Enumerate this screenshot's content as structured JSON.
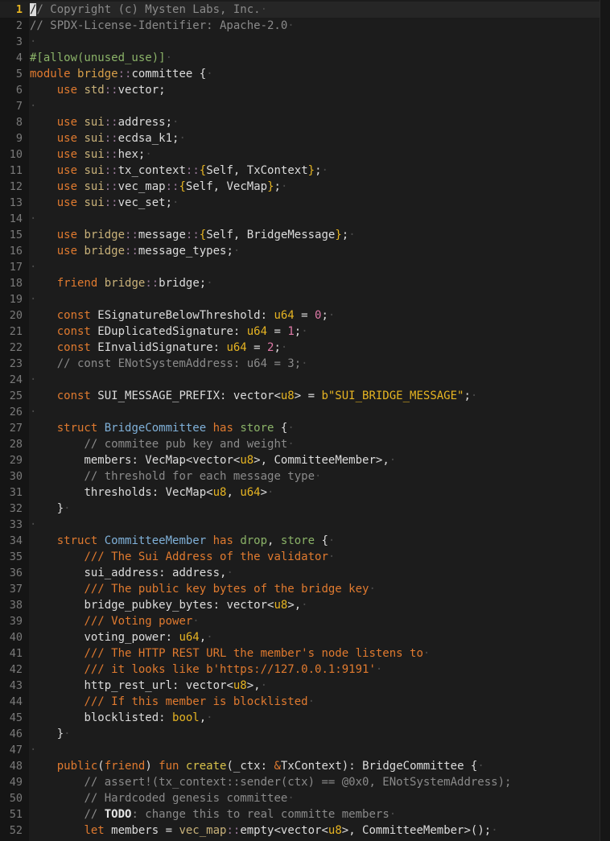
{
  "editor": {
    "active_line": 1,
    "lines": [
      [
        [
          "cmt",
          "// Copyright (c) Mysten Labs, Inc."
        ],
        [
          "ws",
          "·"
        ]
      ],
      [
        [
          "cmt",
          "// SPDX-License-Identifier: Apache-2.0"
        ],
        [
          "ws",
          "·"
        ]
      ],
      [
        [
          "ws",
          "·"
        ]
      ],
      [
        [
          "attr",
          "#[allow(unused_use)]"
        ],
        [
          "ws",
          "·"
        ]
      ],
      [
        [
          "kw",
          "module "
        ],
        [
          "mod",
          "bridge"
        ],
        [
          "sep",
          "::"
        ],
        [
          "name",
          "committee "
        ],
        [
          "name",
          "{"
        ],
        [
          "ws",
          "·"
        ]
      ],
      [
        [
          "name",
          "    "
        ],
        [
          "kw",
          "use "
        ],
        [
          "path",
          "std"
        ],
        [
          "sep",
          "::"
        ],
        [
          "name",
          "vector;"
        ]
      ],
      [
        [
          "ws",
          "·"
        ]
      ],
      [
        [
          "name",
          "    "
        ],
        [
          "kw",
          "use "
        ],
        [
          "path",
          "sui"
        ],
        [
          "sep",
          "::"
        ],
        [
          "name",
          "address;"
        ],
        [
          "ws",
          "·"
        ]
      ],
      [
        [
          "name",
          "    "
        ],
        [
          "kw",
          "use "
        ],
        [
          "path",
          "sui"
        ],
        [
          "sep",
          "::"
        ],
        [
          "name",
          "ecdsa_k1;"
        ],
        [
          "ws",
          "·"
        ]
      ],
      [
        [
          "name",
          "    "
        ],
        [
          "kw",
          "use "
        ],
        [
          "path",
          "sui"
        ],
        [
          "sep",
          "::"
        ],
        [
          "name",
          "hex;"
        ],
        [
          "ws",
          "·"
        ]
      ],
      [
        [
          "name",
          "    "
        ],
        [
          "kw",
          "use "
        ],
        [
          "path",
          "sui"
        ],
        [
          "sep",
          "::"
        ],
        [
          "name",
          "tx_context"
        ],
        [
          "sep",
          "::"
        ],
        [
          "type",
          "{"
        ],
        [
          "name",
          "Self, TxContext"
        ],
        [
          "type",
          "}"
        ],
        [
          "name",
          ";"
        ],
        [
          "ws",
          "·"
        ]
      ],
      [
        [
          "name",
          "    "
        ],
        [
          "kw",
          "use "
        ],
        [
          "path",
          "sui"
        ],
        [
          "sep",
          "::"
        ],
        [
          "name",
          "vec_map"
        ],
        [
          "sep",
          "::"
        ],
        [
          "type",
          "{"
        ],
        [
          "name",
          "Self, VecMap"
        ],
        [
          "type",
          "}"
        ],
        [
          "name",
          ";"
        ],
        [
          "ws",
          "·"
        ]
      ],
      [
        [
          "name",
          "    "
        ],
        [
          "kw",
          "use "
        ],
        [
          "path",
          "sui"
        ],
        [
          "sep",
          "::"
        ],
        [
          "name",
          "vec_set;"
        ],
        [
          "ws",
          "·"
        ]
      ],
      [
        [
          "ws",
          "·"
        ]
      ],
      [
        [
          "name",
          "    "
        ],
        [
          "kw",
          "use "
        ],
        [
          "path",
          "bridge"
        ],
        [
          "sep",
          "::"
        ],
        [
          "name",
          "message"
        ],
        [
          "sep",
          "::"
        ],
        [
          "type",
          "{"
        ],
        [
          "name",
          "Self, BridgeMessage"
        ],
        [
          "type",
          "}"
        ],
        [
          "name",
          ";"
        ],
        [
          "ws",
          "·"
        ]
      ],
      [
        [
          "name",
          "    "
        ],
        [
          "kw",
          "use "
        ],
        [
          "path",
          "bridge"
        ],
        [
          "sep",
          "::"
        ],
        [
          "name",
          "message_types;"
        ],
        [
          "ws",
          "·"
        ]
      ],
      [
        [
          "ws",
          "·"
        ]
      ],
      [
        [
          "name",
          "    "
        ],
        [
          "kw",
          "friend "
        ],
        [
          "path",
          "bridge"
        ],
        [
          "sep",
          "::"
        ],
        [
          "name",
          "bridge;"
        ],
        [
          "ws",
          "·"
        ]
      ],
      [
        [
          "ws",
          "·"
        ]
      ],
      [
        [
          "name",
          "    "
        ],
        [
          "kw",
          "const "
        ],
        [
          "name",
          "ESignatureBelowThreshold: "
        ],
        [
          "type",
          "u64"
        ],
        [
          "name",
          " = "
        ],
        [
          "num",
          "0"
        ],
        [
          "name",
          ";"
        ],
        [
          "ws",
          "·"
        ]
      ],
      [
        [
          "name",
          "    "
        ],
        [
          "kw",
          "const "
        ],
        [
          "name",
          "EDuplicatedSignature: "
        ],
        [
          "type",
          "u64"
        ],
        [
          "name",
          " = "
        ],
        [
          "num",
          "1"
        ],
        [
          "name",
          ";"
        ],
        [
          "ws",
          "·"
        ]
      ],
      [
        [
          "name",
          "    "
        ],
        [
          "kw",
          "const "
        ],
        [
          "name",
          "EInvalidSignature: "
        ],
        [
          "type",
          "u64"
        ],
        [
          "name",
          " = "
        ],
        [
          "num",
          "2"
        ],
        [
          "name",
          ";"
        ],
        [
          "ws",
          "·"
        ]
      ],
      [
        [
          "name",
          "    "
        ],
        [
          "cmt",
          "// const ENotSystemAddress: u64 = 3;"
        ],
        [
          "ws",
          "·"
        ]
      ],
      [
        [
          "ws",
          "·"
        ]
      ],
      [
        [
          "name",
          "    "
        ],
        [
          "kw",
          "const "
        ],
        [
          "name",
          "SUI_MESSAGE_PREFIX: vector<"
        ],
        [
          "type",
          "u8"
        ],
        [
          "name",
          "> = "
        ],
        [
          "str",
          "b\"SUI_BRIDGE_MESSAGE\""
        ],
        [
          "name",
          ";"
        ],
        [
          "ws",
          "·"
        ]
      ],
      [
        [
          "ws",
          "·"
        ]
      ],
      [
        [
          "name",
          "    "
        ],
        [
          "kw",
          "struct "
        ],
        [
          "struct",
          "BridgeCommittee "
        ],
        [
          "kw",
          "has "
        ],
        [
          "attr",
          "store "
        ],
        [
          "name",
          "{"
        ],
        [
          "ws",
          "·"
        ]
      ],
      [
        [
          "name",
          "        "
        ],
        [
          "cmt",
          "// commitee pub key and weight"
        ],
        [
          "ws",
          "·"
        ]
      ],
      [
        [
          "name",
          "        "
        ],
        [
          "name",
          "members: VecMap<vector<"
        ],
        [
          "type",
          "u8"
        ],
        [
          "name",
          ">, CommitteeMember>,"
        ],
        [
          "ws",
          "·"
        ]
      ],
      [
        [
          "name",
          "        "
        ],
        [
          "cmt",
          "// threshold for each message type"
        ],
        [
          "ws",
          "·"
        ]
      ],
      [
        [
          "name",
          "        "
        ],
        [
          "name",
          "thresholds: VecMap<"
        ],
        [
          "type",
          "u8"
        ],
        [
          "name",
          ", "
        ],
        [
          "type",
          "u64"
        ],
        [
          "name",
          ">"
        ],
        [
          "ws",
          "·"
        ]
      ],
      [
        [
          "name",
          "    }"
        ],
        [
          "ws",
          "·"
        ]
      ],
      [
        [
          "ws",
          "·"
        ]
      ],
      [
        [
          "name",
          "    "
        ],
        [
          "kw",
          "struct "
        ],
        [
          "struct",
          "CommitteeMember "
        ],
        [
          "kw",
          "has "
        ],
        [
          "attr",
          "drop"
        ],
        [
          "name",
          ", "
        ],
        [
          "attr",
          "store "
        ],
        [
          "name",
          "{"
        ],
        [
          "ws",
          "·"
        ]
      ],
      [
        [
          "name",
          "        "
        ],
        [
          "doc",
          "/// The Sui Address of the validator"
        ],
        [
          "ws",
          "·"
        ]
      ],
      [
        [
          "name",
          "        "
        ],
        [
          "name",
          "sui_address: address,"
        ],
        [
          "ws",
          "·"
        ]
      ],
      [
        [
          "name",
          "        "
        ],
        [
          "doc",
          "/// The public key bytes of the bridge key"
        ],
        [
          "ws",
          "·"
        ]
      ],
      [
        [
          "name",
          "        "
        ],
        [
          "name",
          "bridge_pubkey_bytes: vector<"
        ],
        [
          "type",
          "u8"
        ],
        [
          "name",
          ">,"
        ],
        [
          "ws",
          "·"
        ]
      ],
      [
        [
          "name",
          "        "
        ],
        [
          "doc",
          "/// Voting power"
        ],
        [
          "ws",
          "·"
        ]
      ],
      [
        [
          "name",
          "        "
        ],
        [
          "name",
          "voting_power: "
        ],
        [
          "type",
          "u64"
        ],
        [
          "name",
          ","
        ],
        [
          "ws",
          "·"
        ]
      ],
      [
        [
          "name",
          "        "
        ],
        [
          "doc",
          "/// The HTTP REST URL the member's node listens to"
        ],
        [
          "ws",
          "·"
        ]
      ],
      [
        [
          "name",
          "        "
        ],
        [
          "doc",
          "/// it looks like b'https://127.0.0.1:9191'"
        ],
        [
          "ws",
          "·"
        ]
      ],
      [
        [
          "name",
          "        "
        ],
        [
          "name",
          "http_rest_url: vector<"
        ],
        [
          "type",
          "u8"
        ],
        [
          "name",
          ">,"
        ],
        [
          "ws",
          "·"
        ]
      ],
      [
        [
          "name",
          "        "
        ],
        [
          "doc",
          "/// If this member is blocklisted"
        ],
        [
          "ws",
          "·"
        ]
      ],
      [
        [
          "name",
          "        "
        ],
        [
          "name",
          "blocklisted: "
        ],
        [
          "type",
          "bool"
        ],
        [
          "name",
          ","
        ],
        [
          "ws",
          "·"
        ]
      ],
      [
        [
          "name",
          "    }"
        ],
        [
          "ws",
          "·"
        ]
      ],
      [
        [
          "ws",
          "·"
        ]
      ],
      [
        [
          "name",
          "    "
        ],
        [
          "kw",
          "public"
        ],
        [
          "name",
          "("
        ],
        [
          "kw",
          "friend"
        ],
        [
          "name",
          ") "
        ],
        [
          "kw",
          "fun "
        ],
        [
          "fn",
          "create"
        ],
        [
          "name",
          "(_ctx: "
        ],
        [
          "kw",
          "&"
        ],
        [
          "name",
          "TxContext): BridgeCommittee {"
        ],
        [
          "ws",
          "·"
        ]
      ],
      [
        [
          "name",
          "        "
        ],
        [
          "cmt",
          "// assert!(tx_context::sender(ctx) == @0x0, ENotSystemAddress);"
        ]
      ],
      [
        [
          "name",
          "        "
        ],
        [
          "cmt",
          "// Hardcoded genesis committee"
        ],
        [
          "ws",
          "·"
        ]
      ],
      [
        [
          "name",
          "        "
        ],
        [
          "cmt",
          "// "
        ],
        [
          "todo",
          "TODO"
        ],
        [
          "cmt",
          ": change this to real committe members"
        ],
        [
          "ws",
          "·"
        ]
      ],
      [
        [
          "name",
          "        "
        ],
        [
          "kw",
          "let "
        ],
        [
          "name",
          "members = "
        ],
        [
          "path",
          "vec_map"
        ],
        [
          "sep",
          "::"
        ],
        [
          "name",
          "empty<vector<"
        ],
        [
          "type",
          "u8"
        ],
        [
          "name",
          ">, CommitteeMember>();"
        ],
        [
          "ws",
          "·"
        ]
      ]
    ]
  }
}
